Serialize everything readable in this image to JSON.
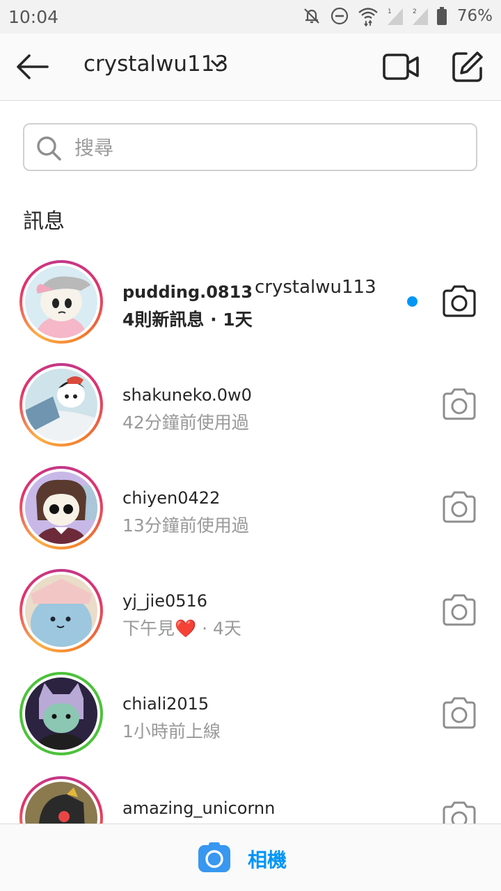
{
  "status_bar": {
    "time": "10:04",
    "battery": "76%"
  },
  "header": {
    "account": "crystalwu113",
    "chevron_icon": "chevron-down-icon",
    "back_icon": "arrow-left-icon",
    "video_icon": "video-camera-icon",
    "compose_icon": "compose-icon"
  },
  "search": {
    "placeholder": "搜尋"
  },
  "section_title": "訊息",
  "threads": [
    {
      "name": "pudding.0813",
      "name2": "crystalwu113",
      "sub": "4則新訊息 · 1天",
      "unread": true
    },
    {
      "name": "shakuneko.0w0",
      "sub": "42分鐘前使用過"
    },
    {
      "name": "chiyen0422",
      "sub": "13分鐘前使用過"
    },
    {
      "name": "yj_jie0516",
      "sub_text": "下午見",
      "sub_emoji": "❤️",
      "sub_time": " · 4天"
    },
    {
      "name": "chiali2015",
      "sub": "1小時前上線"
    },
    {
      "name": "amazing_unicornn",
      "sub": ""
    }
  ],
  "bottom_bar": {
    "label": "相機"
  },
  "colors": {
    "accent": "#0095f6",
    "ring_green": "#4cc23a"
  }
}
